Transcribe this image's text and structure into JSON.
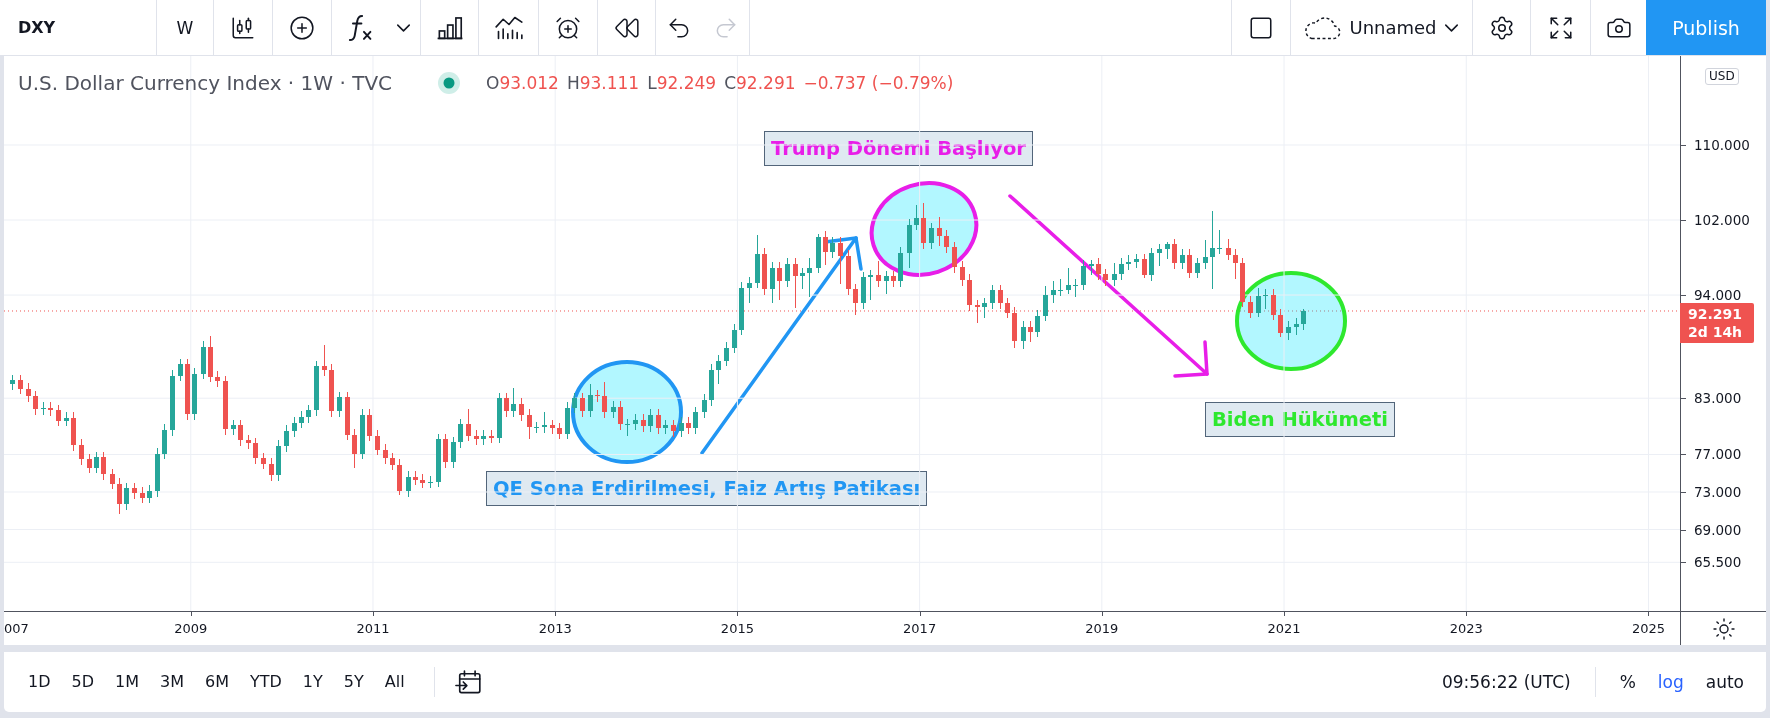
{
  "toolbar": {
    "symbol": "DXY",
    "interval": "W",
    "undo": {
      "disabled": false
    },
    "redo": {
      "disabled": true
    },
    "layout_name": "Unnamed",
    "publish": "Publish"
  },
  "legend": {
    "title": "U.S. Dollar Currency Index · 1W · TVC",
    "market_open": true,
    "price_falling": true,
    "ohlc": [
      {
        "label": "O",
        "value": "93.012"
      },
      {
        "label": "H",
        "value": "93.111"
      },
      {
        "label": "L",
        "value": "92.249"
      },
      {
        "label": "C",
        "value": "92.291"
      }
    ],
    "change": "−0.737 (−0.79%)"
  },
  "chart": {
    "currency": "USD",
    "last_price": {
      "price": "92.291",
      "countdown": "2d 14h"
    },
    "time_axis_edge_label": "007",
    "chart_data": {
      "type": "candlestick",
      "grid": true,
      "xlim": [
        2006.95,
        2026.29
      ],
      "ylim": [
        60.31,
        119.49
      ],
      "xticks": [
        2009,
        2011,
        2013,
        2015,
        2017,
        2019,
        2021,
        2023,
        2025
      ],
      "yticks": [
        {
          "value": 110,
          "label": "110.000"
        },
        {
          "value": 102,
          "label": "102.000"
        },
        {
          "value": 94,
          "label": "94.000"
        },
        {
          "value": 83,
          "label": "83.000"
        },
        {
          "value": 77,
          "label": "77.000"
        },
        {
          "value": 73,
          "label": "73.000"
        },
        {
          "value": 69,
          "label": "69.000"
        },
        {
          "value": 65.5,
          "label": "65.500"
        }
      ],
      "x": [
        2007.04,
        2007.13,
        2007.21,
        2007.29,
        2007.38,
        2007.46,
        2007.54,
        2007.63,
        2007.71,
        2007.79,
        2007.88,
        2007.96,
        2008.04,
        2008.13,
        2008.21,
        2008.29,
        2008.38,
        2008.46,
        2008.54,
        2008.63,
        2008.71,
        2008.79,
        2008.88,
        2008.96,
        2009.04,
        2009.13,
        2009.21,
        2009.29,
        2009.38,
        2009.46,
        2009.54,
        2009.63,
        2009.71,
        2009.79,
        2009.88,
        2009.96,
        2010.04,
        2010.13,
        2010.21,
        2010.29,
        2010.38,
        2010.46,
        2010.54,
        2010.63,
        2010.71,
        2010.79,
        2010.88,
        2010.96,
        2011.04,
        2011.13,
        2011.21,
        2011.29,
        2011.38,
        2011.46,
        2011.54,
        2011.63,
        2011.71,
        2011.79,
        2011.88,
        2011.96,
        2012.04,
        2012.13,
        2012.21,
        2012.29,
        2012.38,
        2012.46,
        2012.54,
        2012.63,
        2012.71,
        2012.79,
        2012.88,
        2012.96,
        2013.04,
        2013.13,
        2013.21,
        2013.29,
        2013.38,
        2013.46,
        2013.54,
        2013.63,
        2013.71,
        2013.79,
        2013.88,
        2013.96,
        2014.04,
        2014.13,
        2014.21,
        2014.29,
        2014.38,
        2014.46,
        2014.54,
        2014.63,
        2014.71,
        2014.79,
        2014.88,
        2014.96,
        2015.04,
        2015.13,
        2015.21,
        2015.29,
        2015.38,
        2015.46,
        2015.54,
        2015.63,
        2015.71,
        2015.79,
        2015.88,
        2015.96,
        2016.04,
        2016.13,
        2016.21,
        2016.29,
        2016.38,
        2016.46,
        2016.54,
        2016.63,
        2016.71,
        2016.79,
        2016.88,
        2016.96,
        2017.04,
        2017.13,
        2017.21,
        2017.29,
        2017.38,
        2017.46,
        2017.54,
        2017.63,
        2017.71,
        2017.79,
        2017.88,
        2017.96,
        2018.04,
        2018.13,
        2018.21,
        2018.29,
        2018.38,
        2018.46,
        2018.54,
        2018.63,
        2018.71,
        2018.79,
        2018.88,
        2018.96,
        2019.04,
        2019.13,
        2019.21,
        2019.29,
        2019.38,
        2019.46,
        2019.54,
        2019.63,
        2019.71,
        2019.79,
        2019.88,
        2019.96,
        2020.04,
        2020.13,
        2020.21,
        2020.29,
        2020.38,
        2020.46,
        2020.54,
        2020.63,
        2020.71,
        2020.79,
        2020.88,
        2020.96,
        2021.04,
        2021.13,
        2021.21
      ],
      "ohlc": [
        [
          84.5,
          85.5,
          83.9,
          84.9
        ],
        [
          84.9,
          85.5,
          83.4,
          84.0
        ],
        [
          84.0,
          84.6,
          82.6,
          83.2
        ],
        [
          83.2,
          83.8,
          81.2,
          81.8
        ],
        [
          81.8,
          82.6,
          81.2,
          82.0
        ],
        [
          82.0,
          82.6,
          81.1,
          81.7
        ],
        [
          81.7,
          82.3,
          80.0,
          80.6
        ],
        [
          80.6,
          81.5,
          80.0,
          80.9
        ],
        [
          80.9,
          81.5,
          77.4,
          78.0
        ],
        [
          78.0,
          78.6,
          75.9,
          76.5
        ],
        [
          76.5,
          77.1,
          75.0,
          75.6
        ],
        [
          75.6,
          77.3,
          75.0,
          76.7
        ],
        [
          76.7,
          77.3,
          74.3,
          74.9
        ],
        [
          74.9,
          75.5,
          73.3,
          73.9
        ],
        [
          73.9,
          74.5,
          70.7,
          71.7
        ],
        [
          71.7,
          74.0,
          71.1,
          73.4
        ],
        [
          73.4,
          74.0,
          72.3,
          72.9
        ],
        [
          72.9,
          73.5,
          71.8,
          72.4
        ],
        [
          72.4,
          73.7,
          71.8,
          73.1
        ],
        [
          73.1,
          77.7,
          72.5,
          77.1
        ],
        [
          77.1,
          80.2,
          76.5,
          79.6
        ],
        [
          79.6,
          86.0,
          79.0,
          85.4
        ],
        [
          85.4,
          87.2,
          84.8,
          86.6
        ],
        [
          86.6,
          87.2,
          80.7,
          81.3
        ],
        [
          81.3,
          86.2,
          80.7,
          85.6
        ],
        [
          85.6,
          89.1,
          85.0,
          88.5
        ],
        [
          88.5,
          89.6,
          84.7,
          85.3
        ],
        [
          85.3,
          85.9,
          84.2,
          84.8
        ],
        [
          84.8,
          85.4,
          79.1,
          79.7
        ],
        [
          79.7,
          80.7,
          79.1,
          80.1
        ],
        [
          80.1,
          80.7,
          77.9,
          78.5
        ],
        [
          78.5,
          79.1,
          77.6,
          78.2
        ],
        [
          78.2,
          78.8,
          76.0,
          76.6
        ],
        [
          76.6,
          77.2,
          75.4,
          76.0
        ],
        [
          76.0,
          76.6,
          74.2,
          74.8
        ],
        [
          74.8,
          78.5,
          74.2,
          77.9
        ],
        [
          77.9,
          80.1,
          77.3,
          79.5
        ],
        [
          79.5,
          81.0,
          78.9,
          80.4
        ],
        [
          80.4,
          81.6,
          79.8,
          81.0
        ],
        [
          81.0,
          82.3,
          80.4,
          81.7
        ],
        [
          81.7,
          87.0,
          81.1,
          86.4
        ],
        [
          86.4,
          88.7,
          85.4,
          86.0
        ],
        [
          86.0,
          86.6,
          81.0,
          81.6
        ],
        [
          81.6,
          83.7,
          81.0,
          83.1
        ],
        [
          83.1,
          83.7,
          78.5,
          79.1
        ],
        [
          79.1,
          79.7,
          75.6,
          77.1
        ],
        [
          77.1,
          81.8,
          76.5,
          81.2
        ],
        [
          81.2,
          81.8,
          78.4,
          79.0
        ],
        [
          79.0,
          79.6,
          76.9,
          77.5
        ],
        [
          77.5,
          78.1,
          76.0,
          76.6
        ],
        [
          76.6,
          77.2,
          75.3,
          75.9
        ],
        [
          75.9,
          76.5,
          72.7,
          73.1
        ],
        [
          73.1,
          75.2,
          72.5,
          74.6
        ],
        [
          74.6,
          75.2,
          73.7,
          74.3
        ],
        [
          74.3,
          74.9,
          73.4,
          74.0
        ],
        [
          74.0,
          74.7,
          73.4,
          74.1
        ],
        [
          74.1,
          79.2,
          73.5,
          78.6
        ],
        [
          78.6,
          79.2,
          75.6,
          76.2
        ],
        [
          76.2,
          78.9,
          75.6,
          78.3
        ],
        [
          78.3,
          80.8,
          77.7,
          80.2
        ],
        [
          80.2,
          81.8,
          78.4,
          79.0
        ],
        [
          79.0,
          79.6,
          78.0,
          78.6
        ],
        [
          78.6,
          79.6,
          78.0,
          79.0
        ],
        [
          79.0,
          79.6,
          78.2,
          78.8
        ],
        [
          78.8,
          83.6,
          78.2,
          83.0
        ],
        [
          83.0,
          83.6,
          81.0,
          81.6
        ],
        [
          81.6,
          84.1,
          81.0,
          82.4
        ],
        [
          82.4,
          83.0,
          80.6,
          81.2
        ],
        [
          81.2,
          81.8,
          78.6,
          79.9
        ],
        [
          79.9,
          80.5,
          79.3,
          79.9
        ],
        [
          79.9,
          81.5,
          79.3,
          80.1
        ],
        [
          80.1,
          80.7,
          79.2,
          79.8
        ],
        [
          79.8,
          80.4,
          78.6,
          79.2
        ],
        [
          79.2,
          82.6,
          78.6,
          82.0
        ],
        [
          82.0,
          83.6,
          81.4,
          83.0
        ],
        [
          83.0,
          83.6,
          81.0,
          81.6
        ],
        [
          81.6,
          84.5,
          81.0,
          83.3
        ],
        [
          83.3,
          83.9,
          82.6,
          83.2
        ],
        [
          83.2,
          84.7,
          80.9,
          81.5
        ],
        [
          81.5,
          82.7,
          80.9,
          82.1
        ],
        [
          82.1,
          82.7,
          79.6,
          80.2
        ],
        [
          80.2,
          80.8,
          79.0,
          80.2
        ],
        [
          80.2,
          81.3,
          79.6,
          80.7
        ],
        [
          80.7,
          81.3,
          79.4,
          80.0
        ],
        [
          80.0,
          81.8,
          79.4,
          81.2
        ],
        [
          81.2,
          81.8,
          79.2,
          79.8
        ],
        [
          79.8,
          80.7,
          79.2,
          80.1
        ],
        [
          80.1,
          80.7,
          78.9,
          79.5
        ],
        [
          79.5,
          81.0,
          78.9,
          80.4
        ],
        [
          80.4,
          81.0,
          79.2,
          79.8
        ],
        [
          79.8,
          82.1,
          79.2,
          81.5
        ],
        [
          81.5,
          83.4,
          80.9,
          82.8
        ],
        [
          82.8,
          86.6,
          82.2,
          86.0
        ],
        [
          86.0,
          87.6,
          84.5,
          87.0
        ],
        [
          87.0,
          89.0,
          86.4,
          88.4
        ],
        [
          88.4,
          90.9,
          87.8,
          90.3
        ],
        [
          90.3,
          95.4,
          89.7,
          94.8
        ],
        [
          94.8,
          95.9,
          93.2,
          95.3
        ],
        [
          95.3,
          100.4,
          94.7,
          98.4
        ],
        [
          98.4,
          99.0,
          94.0,
          94.6
        ],
        [
          94.6,
          97.5,
          93.1,
          96.9
        ],
        [
          96.9,
          97.5,
          93.5,
          95.5
        ],
        [
          95.5,
          98.0,
          94.9,
          97.3
        ],
        [
          97.3,
          97.9,
          92.6,
          96.0
        ],
        [
          96.0,
          96.9,
          94.6,
          96.3
        ],
        [
          96.3,
          97.9,
          93.8,
          96.9
        ],
        [
          96.9,
          100.5,
          96.3,
          100.2
        ],
        [
          100.2,
          100.8,
          97.2,
          98.6
        ],
        [
          98.6,
          100.2,
          98.0,
          99.6
        ],
        [
          99.6,
          100.2,
          95.2,
          98.2
        ],
        [
          98.2,
          98.8,
          94.0,
          94.6
        ],
        [
          94.6,
          95.2,
          91.9,
          93.1
        ],
        [
          93.1,
          96.5,
          92.5,
          95.9
        ],
        [
          95.9,
          96.7,
          93.5,
          96.1
        ],
        [
          96.1,
          97.6,
          94.9,
          95.5
        ],
        [
          95.5,
          96.6,
          94.1,
          96.0
        ],
        [
          96.0,
          96.6,
          94.9,
          95.5
        ],
        [
          95.5,
          99.1,
          94.9,
          98.5
        ],
        [
          98.5,
          102.1,
          96.9,
          101.5
        ],
        [
          101.5,
          103.6,
          100.9,
          102.2
        ],
        [
          102.2,
          103.8,
          98.9,
          99.5
        ],
        [
          99.5,
          101.7,
          98.9,
          101.1
        ],
        [
          101.1,
          102.3,
          99.2,
          100.3
        ],
        [
          100.3,
          100.9,
          98.5,
          99.1
        ],
        [
          99.1,
          99.7,
          96.4,
          97.0
        ],
        [
          97.0,
          97.6,
          95.0,
          95.6
        ],
        [
          95.6,
          96.2,
          92.3,
          92.9
        ],
        [
          92.9,
          93.5,
          91.0,
          92.7
        ],
        [
          92.7,
          93.7,
          91.5,
          93.1
        ],
        [
          93.1,
          95.1,
          92.5,
          94.5
        ],
        [
          94.5,
          95.1,
          92.5,
          93.1
        ],
        [
          93.1,
          93.7,
          91.5,
          92.1
        ],
        [
          92.1,
          92.7,
          88.4,
          89.1
        ],
        [
          89.1,
          91.2,
          88.2,
          90.6
        ],
        [
          90.6,
          91.2,
          89.0,
          90.1
        ],
        [
          90.1,
          92.4,
          89.5,
          91.8
        ],
        [
          91.8,
          95.0,
          91.2,
          94.0
        ],
        [
          94.0,
          95.5,
          93.2,
          94.5
        ],
        [
          94.5,
          95.7,
          93.9,
          94.5
        ],
        [
          94.5,
          96.9,
          94.1,
          95.1
        ],
        [
          95.1,
          95.7,
          93.8,
          95.1
        ],
        [
          95.1,
          97.7,
          94.5,
          97.1
        ],
        [
          97.1,
          97.7,
          96.1,
          97.3
        ],
        [
          97.3,
          97.9,
          95.6,
          96.2
        ],
        [
          96.2,
          96.8,
          95.0,
          95.6
        ],
        [
          95.6,
          97.4,
          95.0,
          96.2
        ],
        [
          96.2,
          97.9,
          95.6,
          97.3
        ],
        [
          97.3,
          98.3,
          96.7,
          97.5
        ],
        [
          97.5,
          98.4,
          96.9,
          97.8
        ],
        [
          97.8,
          98.4,
          95.8,
          96.1
        ],
        [
          96.1,
          99.0,
          95.5,
          98.5
        ],
        [
          98.5,
          99.4,
          97.1,
          98.9
        ],
        [
          98.9,
          99.7,
          97.8,
          99.4
        ],
        [
          99.4,
          100.0,
          96.8,
          97.4
        ],
        [
          97.4,
          98.9,
          96.8,
          98.3
        ],
        [
          98.3,
          98.9,
          95.8,
          96.4
        ],
        [
          96.4,
          98.0,
          95.8,
          97.4
        ],
        [
          97.4,
          99.9,
          96.8,
          98.1
        ],
        [
          98.1,
          103.0,
          94.6,
          99.0
        ],
        [
          99.0,
          100.9,
          98.4,
          99.0
        ],
        [
          99.0,
          100.0,
          97.7,
          98.3
        ],
        [
          98.3,
          98.9,
          95.7,
          97.4
        ],
        [
          97.4,
          98.0,
          92.7,
          93.3
        ],
        [
          93.3,
          93.9,
          91.5,
          92.1
        ],
        [
          92.1,
          94.7,
          91.7,
          93.9
        ],
        [
          93.9,
          94.6,
          92.5,
          94.0
        ],
        [
          94.0,
          94.6,
          91.3,
          91.9
        ],
        [
          91.9,
          92.5,
          89.5,
          89.9
        ],
        [
          89.9,
          91.2,
          89.2,
          90.6
        ],
        [
          90.6,
          91.6,
          89.7,
          90.9
        ],
        [
          90.9,
          92.5,
          90.3,
          92.3
        ]
      ]
    },
    "drawings": [
      {
        "kind": "ellipse",
        "color": "#2196f3"
      },
      {
        "kind": "arrow",
        "color": "#2196f3"
      },
      {
        "kind": "label",
        "text": "QE Sona Erdirilmesi, Faiz Artış Patikası",
        "color": "#2196f3"
      },
      {
        "kind": "label",
        "text": "Trump Dönemi Başlıyor",
        "color": "#e81ee8"
      },
      {
        "kind": "ellipse",
        "color": "#e81ee8"
      },
      {
        "kind": "arrow",
        "color": "#e81ee8"
      },
      {
        "kind": "ellipse",
        "color": "#2ee82e"
      },
      {
        "kind": "label",
        "text": "Biden Hükümeti",
        "color": "#2ee82e"
      }
    ]
  },
  "bottom_bar": {
    "ranges": [
      {
        "label": "1D",
        "selected": false
      },
      {
        "label": "5D",
        "selected": false
      },
      {
        "label": "1M",
        "selected": false
      },
      {
        "label": "3M",
        "selected": false
      },
      {
        "label": "6M",
        "selected": false
      },
      {
        "label": "YTD",
        "selected": false
      },
      {
        "label": "1Y",
        "selected": false
      },
      {
        "label": "5Y",
        "selected": false
      },
      {
        "label": "All",
        "selected": false
      }
    ],
    "clock": "09:56:22 (UTC)",
    "scale_options": [
      {
        "label": "%",
        "selected": false
      },
      {
        "label": "log",
        "selected": true
      },
      {
        "label": "auto",
        "selected": false
      }
    ]
  }
}
